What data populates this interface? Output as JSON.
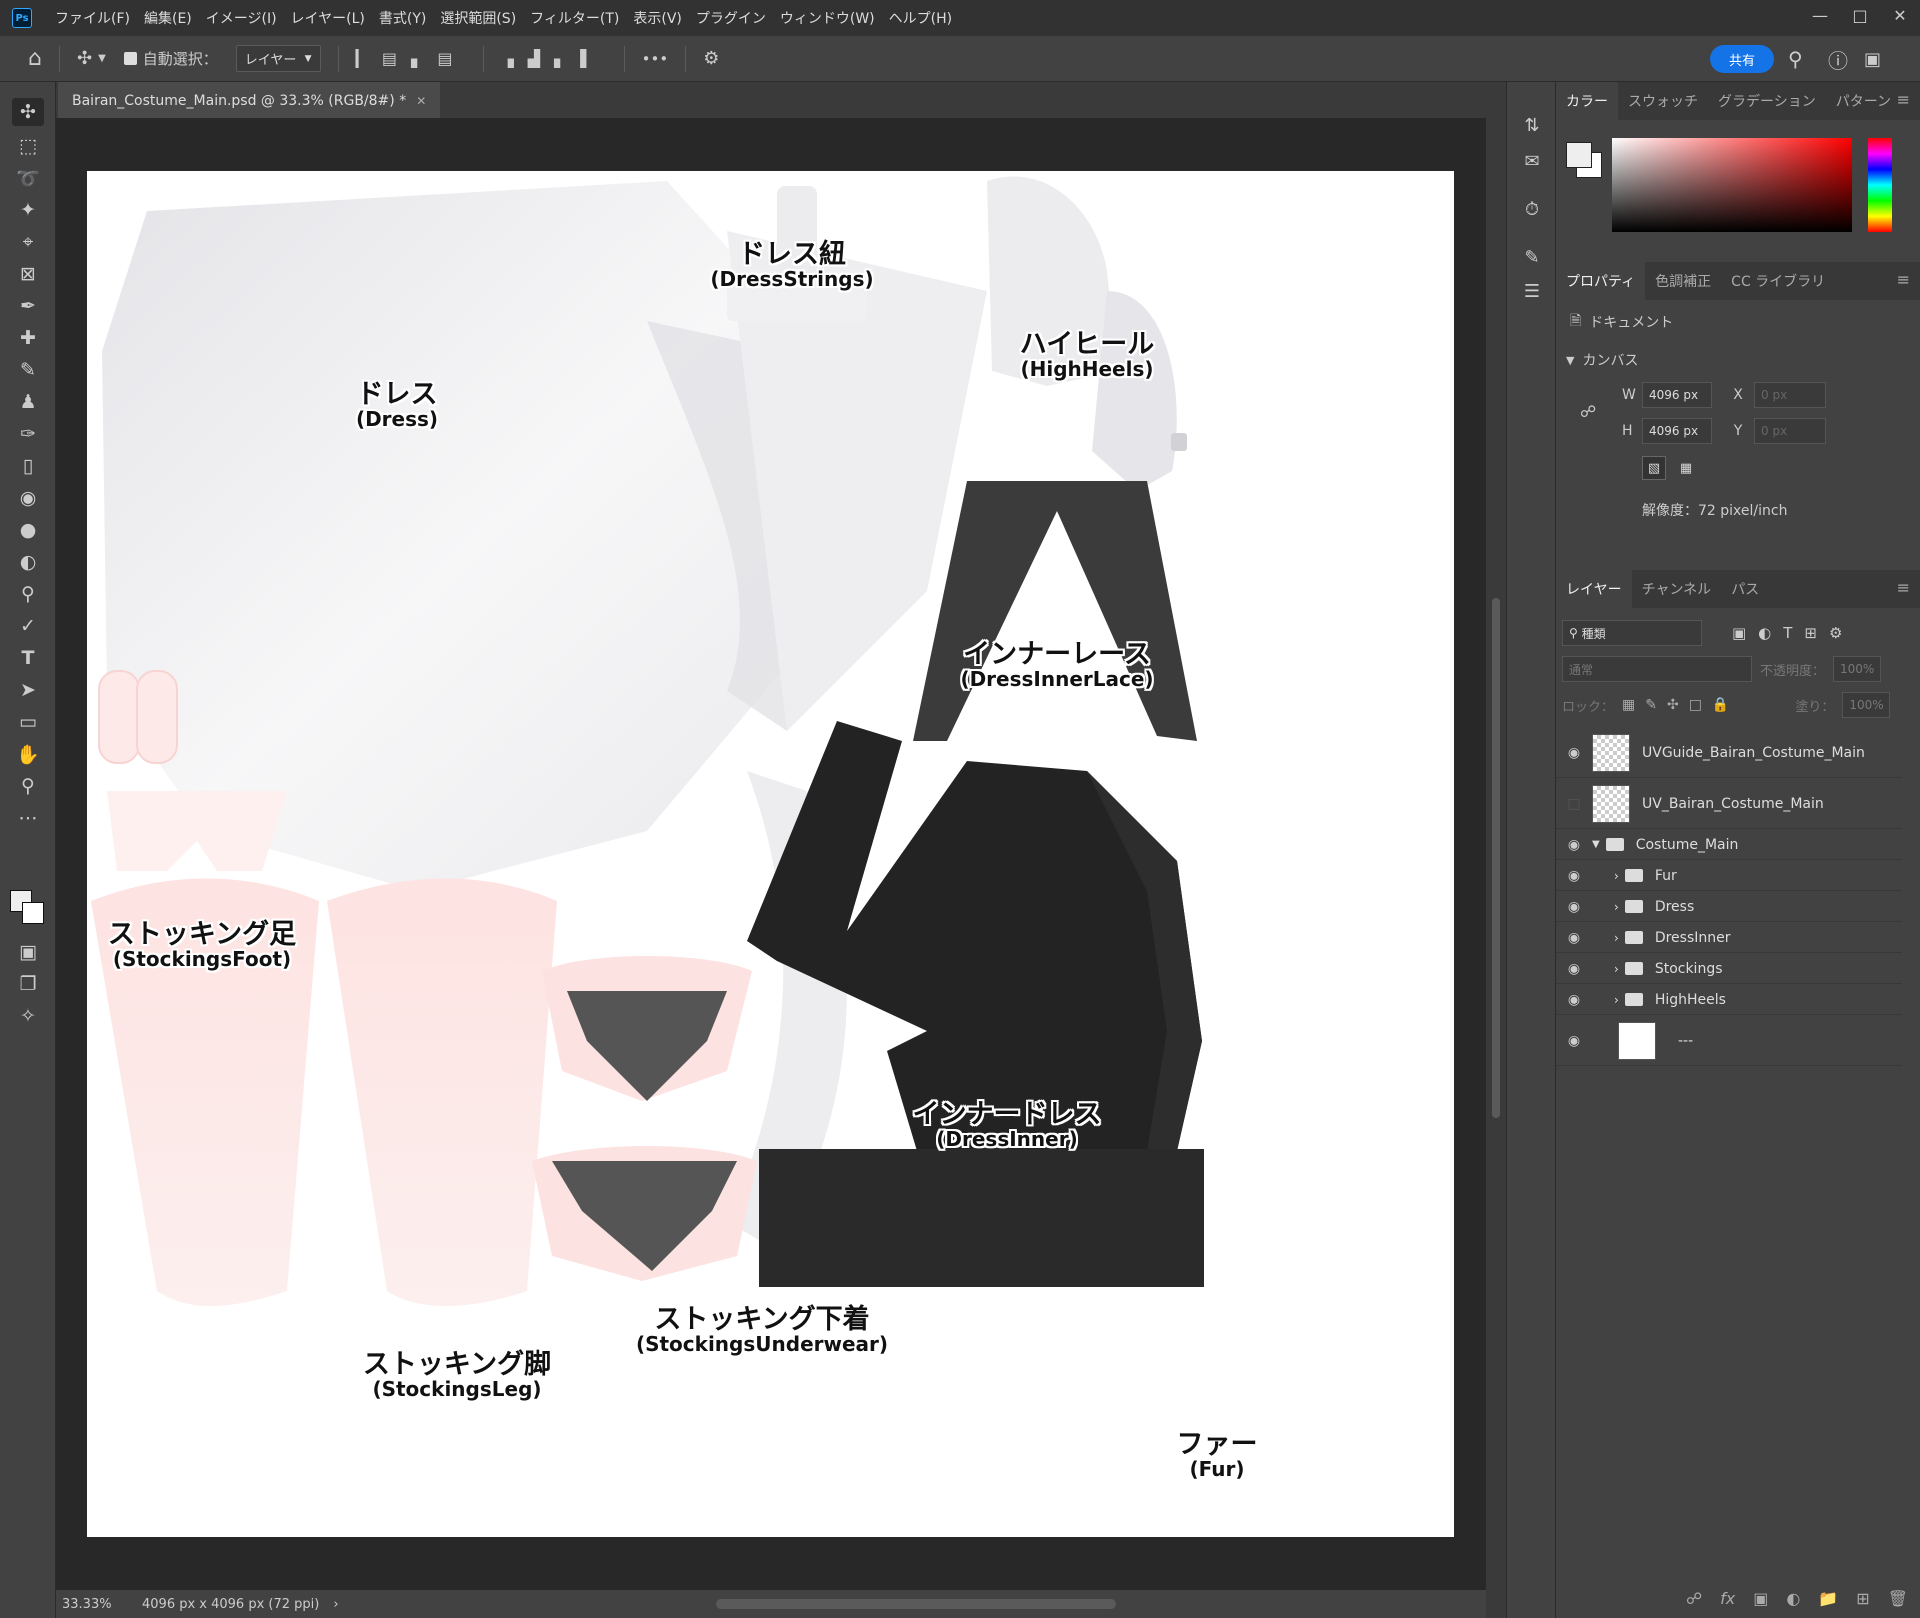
{
  "menu": [
    "ファイル(F)",
    "編集(E)",
    "イメージ(I)",
    "レイヤー(L)",
    "書式(Y)",
    "選択範囲(S)",
    "フィルター(T)",
    "表示(V)",
    "プラグイン",
    "ウィンドウ(W)",
    "ヘルプ(H)"
  ],
  "app_logo": "Ps",
  "options": {
    "auto_select": "自動選択：",
    "target": "レイヤー",
    "share": "共有",
    "more": "•••"
  },
  "document": {
    "tab_title": "Bairan_Costume_Main.psd @ 33.3% (RGB/8#) *",
    "zoom": "33.33%",
    "info": "4096 px x 4096 px (72 ppi)"
  },
  "canvas_labels": [
    {
      "jp": "ドレス紐",
      "en": "(DressStrings)"
    },
    {
      "jp": "ドレス",
      "en": "(Dress)"
    },
    {
      "jp": "ハイヒール",
      "en": "(HighHeels)"
    },
    {
      "jp": "インナーレース",
      "en": "(DressInnerLace)"
    },
    {
      "jp": "ストッキング足",
      "en": "(StockingsFoot)"
    },
    {
      "jp": "インナードレス",
      "en": "(DressInner)"
    },
    {
      "jp": "ストッキング下着",
      "en": "(StockingsUnderwear)"
    },
    {
      "jp": "ストッキング脚",
      "en": "(StockingsLeg)"
    },
    {
      "jp": "ファー",
      "en": "(Fur)"
    }
  ],
  "color_panel": {
    "tabs": [
      "カラー",
      "スウォッチ",
      "グラデーション",
      "パターン"
    ]
  },
  "properties_panel": {
    "tabs": [
      "プロパティ",
      "色調補正",
      "CC ライブラリ"
    ],
    "doc_label": "ドキュメント",
    "section": "カンバス",
    "w_label": "W",
    "w_value": "4096 px",
    "h_label": "H",
    "h_value": "4096 px",
    "x_label": "X",
    "x_value": "0 px",
    "y_label": "Y",
    "y_value": "0 px",
    "resolution": "解像度：72 pixel/inch"
  },
  "layers_panel": {
    "tabs": [
      "レイヤー",
      "チャンネル",
      "パス"
    ],
    "filter_label": "種類",
    "blend_mode": "通常",
    "opacity_label": "不透明度：",
    "opacity_value": "100%",
    "lock_label": "ロック：",
    "fill_label": "塗り：",
    "fill_value": "100%",
    "layers": [
      {
        "name": "UVGuide_Bairan_Costume_Main",
        "visible": true
      },
      {
        "name": "UV_Bairan_Costume_Main",
        "visible": false
      },
      {
        "name": "Costume_Main",
        "visible": true
      },
      {
        "name": "Fur",
        "visible": true
      },
      {
        "name": "Dress",
        "visible": true
      },
      {
        "name": "DressInner",
        "visible": true
      },
      {
        "name": "Stockings",
        "visible": true
      },
      {
        "name": "HighHeels",
        "visible": true
      },
      {
        "name": "---",
        "visible": true
      }
    ]
  }
}
